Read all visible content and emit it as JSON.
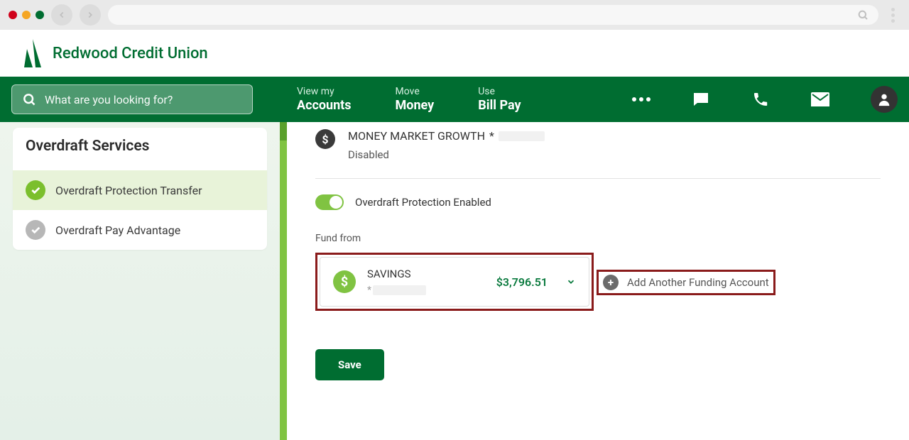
{
  "logo": {
    "text": "Redwood Credit Union"
  },
  "search": {
    "placeholder": "What are you looking for?"
  },
  "nav": {
    "links": [
      {
        "small": "View my",
        "big": "Accounts"
      },
      {
        "small": "Move",
        "big": "Money"
      },
      {
        "small": "Use",
        "big": "Bill Pay"
      }
    ]
  },
  "sidebar": {
    "title": "Overdraft Services",
    "items": [
      {
        "label": "Overdraft Protection Transfer",
        "active": true
      },
      {
        "label": "Overdraft Pay Advantage",
        "active": false
      }
    ]
  },
  "account": {
    "name": "MONEY MARKET GROWTH",
    "mask_prefix": "*",
    "status": "Disabled"
  },
  "toggle": {
    "label": "Overdraft Protection Enabled",
    "on": true
  },
  "fund": {
    "section_label": "Fund from",
    "name": "SAVINGS",
    "mask_prefix": "*",
    "amount": "$3,796.51"
  },
  "add_another": {
    "label": "Add Another Funding Account"
  },
  "buttons": {
    "save": "Save"
  }
}
